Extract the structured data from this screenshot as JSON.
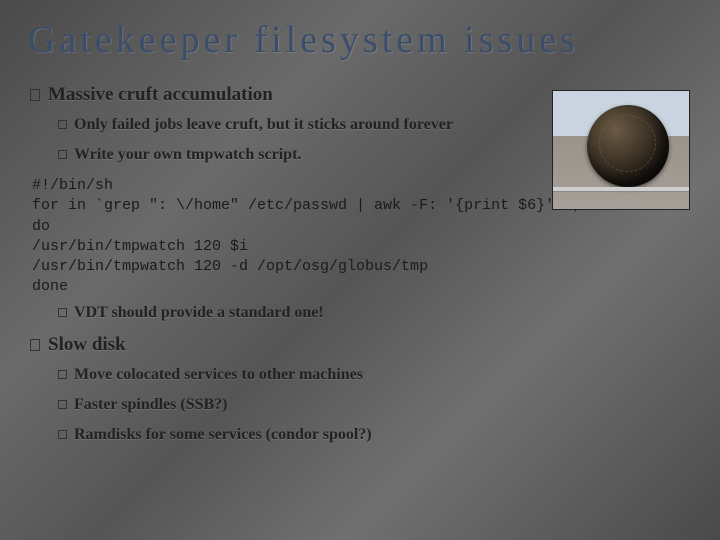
{
  "title": "Gatekeeper filesystem issues",
  "b1": {
    "text": "Massive cruft accumulation",
    "sub1": "Only failed jobs leave cruft, but it sticks around forever",
    "sub2": "Write your own tmpwatch script.",
    "sub3": "VDT should provide a standard one!"
  },
  "code": "#!/bin/sh\nfor in `grep \": \\/home\" /etc/passwd | awk -F: '{print $6}' `;\ndo\n/usr/bin/tmpwatch 120 $i\n/usr/bin/tmpwatch 120 -d /opt/osg/globus/tmp\ndone",
  "b2": {
    "text": "Slow disk",
    "sub1": "Move colocated services to other machines",
    "sub2": "Faster spindles (SSB?)",
    "sub3": "Ramdisks for some services (condor spool?)"
  }
}
